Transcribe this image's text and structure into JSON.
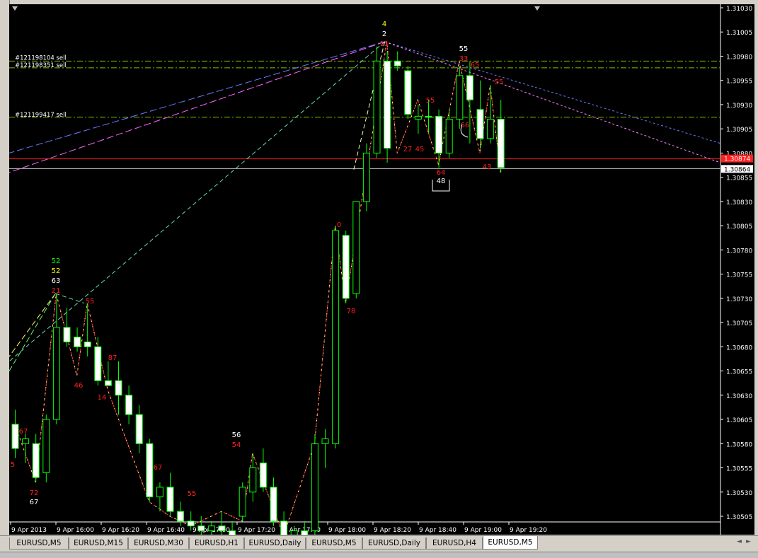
{
  "chart_data": {
    "type": "candlestick",
    "symbol": "EURUSD",
    "timeframe": "M5",
    "price_axis": {
      "min": 1.30505,
      "max": 1.3103,
      "ticks": [
        "1.31030",
        "1.31005",
        "1.30980",
        "1.30955",
        "1.30930",
        "1.30905",
        "1.30880",
        "1.30855",
        "1.30830",
        "1.30805",
        "1.30780",
        "1.30755",
        "1.30730",
        "1.30705",
        "1.30680",
        "1.30655",
        "1.30630",
        "1.30605",
        "1.30580",
        "1.30555",
        "1.30530",
        "1.30505"
      ],
      "bid_label": "1.30874",
      "last_label": "1.30864"
    },
    "time_axis": {
      "labels": [
        "9 Apr 2013",
        "9 Apr 16:00",
        "9 Apr 16:20",
        "9 Apr 16:40",
        "9 Apr 17:00",
        "9 Apr 17:20",
        "9 Apr 17:40",
        "9 Apr 18:00",
        "9 Apr 18:20",
        "9 Apr 18:40",
        "9 Apr 19:00",
        "9 Apr 19:20"
      ]
    },
    "candles": [
      {
        "o": 1.306,
        "h": 1.30615,
        "l": 1.30565,
        "c": 1.30575
      },
      {
        "o": 1.3058,
        "h": 1.3059,
        "l": 1.3056,
        "c": 1.30585
      },
      {
        "o": 1.3058,
        "h": 1.3059,
        "l": 1.3054,
        "c": 1.30545
      },
      {
        "o": 1.3055,
        "h": 1.3061,
        "l": 1.3054,
        "c": 1.30605
      },
      {
        "o": 1.30605,
        "h": 1.30735,
        "l": 1.306,
        "c": 1.307
      },
      {
        "o": 1.307,
        "h": 1.3072,
        "l": 1.3068,
        "c": 1.30685
      },
      {
        "o": 1.3069,
        "h": 1.307,
        "l": 1.30675,
        "c": 1.3068
      },
      {
        "o": 1.30685,
        "h": 1.30725,
        "l": 1.3067,
        "c": 1.3068
      },
      {
        "o": 1.3068,
        "h": 1.3069,
        "l": 1.3064,
        "c": 1.30645
      },
      {
        "o": 1.30645,
        "h": 1.30665,
        "l": 1.3064,
        "c": 1.3064
      },
      {
        "o": 1.30645,
        "h": 1.30665,
        "l": 1.3061,
        "c": 1.3063
      },
      {
        "o": 1.3063,
        "h": 1.3064,
        "l": 1.306,
        "c": 1.3061
      },
      {
        "o": 1.3061,
        "h": 1.3062,
        "l": 1.3057,
        "c": 1.3058
      },
      {
        "o": 1.3058,
        "h": 1.30585,
        "l": 1.3052,
        "c": 1.30525
      },
      {
        "o": 1.30525,
        "h": 1.3054,
        "l": 1.3051,
        "c": 1.30535
      },
      {
        "o": 1.30535,
        "h": 1.3055,
        "l": 1.30505,
        "c": 1.3051
      },
      {
        "o": 1.3051,
        "h": 1.3052,
        "l": 1.30495,
        "c": 1.305
      },
      {
        "o": 1.305,
        "h": 1.3051,
        "l": 1.3049,
        "c": 1.30495
      },
      {
        "o": 1.30495,
        "h": 1.30505,
        "l": 1.3048,
        "c": 1.3049
      },
      {
        "o": 1.3049,
        "h": 1.305,
        "l": 1.3048,
        "c": 1.30495
      },
      {
        "o": 1.30495,
        "h": 1.3051,
        "l": 1.3048,
        "c": 1.3049
      },
      {
        "o": 1.3049,
        "h": 1.305,
        "l": 1.3048,
        "c": 1.30485
      },
      {
        "o": 1.30505,
        "h": 1.3054,
        "l": 1.305,
        "c": 1.30535
      },
      {
        "o": 1.3053,
        "h": 1.3057,
        "l": 1.3052,
        "c": 1.30555
      },
      {
        "o": 1.3056,
        "h": 1.30575,
        "l": 1.3053,
        "c": 1.30535
      },
      {
        "o": 1.30535,
        "h": 1.30545,
        "l": 1.30495,
        "c": 1.305
      },
      {
        "o": 1.305,
        "h": 1.3051,
        "l": 1.3048,
        "c": 1.30485
      },
      {
        "o": 1.30485,
        "h": 1.30495,
        "l": 1.3048,
        "c": 1.3049
      },
      {
        "o": 1.3049,
        "h": 1.305,
        "l": 1.3048,
        "c": 1.30485
      },
      {
        "o": 1.3049,
        "h": 1.3059,
        "l": 1.30485,
        "c": 1.3058
      },
      {
        "o": 1.3058,
        "h": 1.30595,
        "l": 1.30555,
        "c": 1.30585
      },
      {
        "o": 1.3058,
        "h": 1.30805,
        "l": 1.30575,
        "c": 1.308
      },
      {
        "o": 1.30795,
        "h": 1.308,
        "l": 1.30725,
        "c": 1.3073
      },
      {
        "o": 1.30735,
        "h": 1.3083,
        "l": 1.3073,
        "c": 1.3083
      },
      {
        "o": 1.3083,
        "h": 1.3089,
        "l": 1.3082,
        "c": 1.3088
      },
      {
        "o": 1.3088,
        "h": 1.3099,
        "l": 1.30875,
        "c": 1.30975
      },
      {
        "o": 1.30975,
        "h": 1.30985,
        "l": 1.3087,
        "c": 1.30885
      },
      {
        "o": 1.30975,
        "h": 1.30985,
        "l": 1.30965,
        "c": 1.3097
      },
      {
        "o": 1.30965,
        "h": 1.3097,
        "l": 1.30915,
        "c": 1.3092
      },
      {
        "o": 1.30915,
        "h": 1.3093,
        "l": 1.309,
        "c": 1.30918
      },
      {
        "o": 1.30918,
        "h": 1.30935,
        "l": 1.309,
        "c": 1.30917
      },
      {
        "o": 1.30918,
        "h": 1.30925,
        "l": 1.30865,
        "c": 1.3088
      },
      {
        "o": 1.3088,
        "h": 1.30925,
        "l": 1.30875,
        "c": 1.30915
      },
      {
        "o": 1.30915,
        "h": 1.3097,
        "l": 1.30905,
        "c": 1.3096
      },
      {
        "o": 1.3096,
        "h": 1.30975,
        "l": 1.3089,
        "c": 1.30935
      },
      {
        "o": 1.30925,
        "h": 1.30955,
        "l": 1.30885,
        "c": 1.30895
      },
      {
        "o": 1.30895,
        "h": 1.3095,
        "l": 1.3089,
        "c": 1.30915
      },
      {
        "o": 1.30915,
        "h": 1.30935,
        "l": 1.3086,
        "c": 1.30865
      }
    ],
    "horizontal_lines": [
      {
        "label": "#121198104 sell",
        "price": 1.30975,
        "color": "#7fbf00",
        "style": "dashdot"
      },
      {
        "label": "#121198351 sell",
        "price": 1.30968,
        "color": "#7fbf00",
        "style": "dashdot"
      },
      {
        "label": "#121199417 sell",
        "price": 1.30917,
        "color": "#7fbf00",
        "style": "dashdot"
      },
      {
        "label": "",
        "price": 1.30874,
        "color": "#ff2020",
        "style": "solid"
      },
      {
        "label": "",
        "price": 1.30864,
        "color": "#c0c0c0",
        "style": "solid"
      }
    ],
    "annotations": [
      {
        "text": "4",
        "color": "#ffff00"
      },
      {
        "text": "2",
        "color": "#ffffff"
      },
      {
        "text": "11",
        "color": "#ff2020"
      },
      {
        "text": "55",
        "color": "#ffffff"
      },
      {
        "text": "33",
        "color": "#ff2020"
      },
      {
        "text": "65",
        "color": "#ff2020"
      },
      {
        "text": "55",
        "color": "#ff2020"
      },
      {
        "text": "55",
        "color": "#ff2020"
      },
      {
        "text": "27",
        "color": "#ff2020"
      },
      {
        "text": "45",
        "color": "#ff2020"
      },
      {
        "text": "64",
        "color": "#ff2020"
      },
      {
        "text": "48",
        "color": "#ffffff"
      },
      {
        "text": "43",
        "color": "#ff2020"
      },
      {
        "text": "66",
        "color": "#ff2020"
      },
      {
        "text": "0",
        "color": "#ff2020"
      },
      {
        "text": "78",
        "color": "#ff2020"
      },
      {
        "text": "52",
        "color": "#00ff00"
      },
      {
        "text": "52",
        "color": "#ffff00"
      },
      {
        "text": "63",
        "color": "#ffffff"
      },
      {
        "text": "21",
        "color": "#ff2020"
      },
      {
        "text": "55",
        "color": "#ff2020"
      },
      {
        "text": "46",
        "color": "#ff2020"
      },
      {
        "text": "87",
        "color": "#ff2020"
      },
      {
        "text": "14",
        "color": "#ff2020"
      },
      {
        "text": "67",
        "color": "#ff2020"
      },
      {
        "text": "5",
        "color": "#ff2020"
      },
      {
        "text": "72",
        "color": "#ff2020"
      },
      {
        "text": "67",
        "color": "#ffffff"
      },
      {
        "text": "67",
        "color": "#ff2020"
      },
      {
        "text": "55",
        "color": "#ff2020"
      },
      {
        "text": "56",
        "color": "#ffffff"
      },
      {
        "text": "54",
        "color": "#ff2020"
      }
    ]
  },
  "tabs": [
    "EURUSD,M5",
    "EURUSD,M15",
    "EURUSD,M30",
    "EURUSD,H1",
    "EURUSD,Daily",
    "EURUSD,M5",
    "EURUSD,Daily",
    "EURUSD,H4",
    "EURUSD,M5"
  ],
  "active_tab": 8,
  "colors": {
    "bull_body": "#000000",
    "bear_body": "#ffffff",
    "wick": "#00ff00",
    "background": "#000000",
    "axis_text": "#ffffff"
  }
}
